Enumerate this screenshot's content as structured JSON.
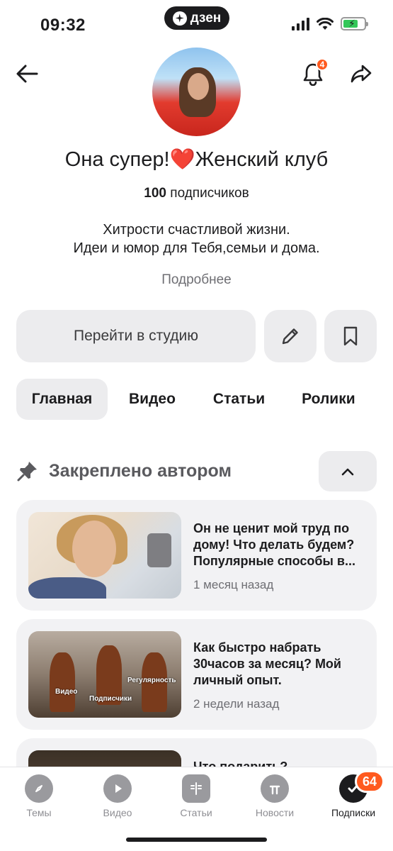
{
  "status_bar": {
    "time": "09:32",
    "app_pill": "дзен"
  },
  "header": {
    "notifications_count": "4"
  },
  "channel": {
    "title": "Она супер!❤️Женский клуб",
    "subscribers_count": "100",
    "subscribers_label": "подписчиков",
    "description_line1": "Хитрости счастливой жизни.",
    "description_line2": "Идеи и юмор для Тебя,семьи и дома.",
    "more_link": "Подробнее"
  },
  "actions": {
    "studio_button": "Перейти в студию"
  },
  "tabs": [
    {
      "label": "Главная",
      "active": true
    },
    {
      "label": "Видео",
      "active": false
    },
    {
      "label": "Статьи",
      "active": false
    },
    {
      "label": "Ролики",
      "active": false
    }
  ],
  "pinned": {
    "title": "Закреплено автором",
    "items": [
      {
        "title": "Он не ценит мой труд по дому! Что делать будем? Популярные способы в...",
        "time": "1 месяц назад"
      },
      {
        "title": "Как быстро набрать 30часов за месяц? Мой личный опыт.",
        "time": "2 недели назад",
        "thumb_labels": [
          "Видео",
          "Подписчики",
          "Регулярность"
        ]
      },
      {
        "title": "Что подарить?",
        "time": ""
      }
    ]
  },
  "bottom_nav": {
    "items": [
      {
        "label": "Темы",
        "icon": "compass-icon"
      },
      {
        "label": "Видео",
        "icon": "play-icon"
      },
      {
        "label": "Статьи",
        "icon": "article-icon"
      },
      {
        "label": "Новости",
        "icon": "news-icon"
      },
      {
        "label": "Подписки",
        "icon": "subscriptions-icon",
        "active": true,
        "badge": "64"
      }
    ]
  },
  "colors": {
    "accent": "#ff5a1f",
    "button_bg": "#ececee",
    "card_bg": "#f2f2f4",
    "muted_text": "#6e6e73"
  }
}
